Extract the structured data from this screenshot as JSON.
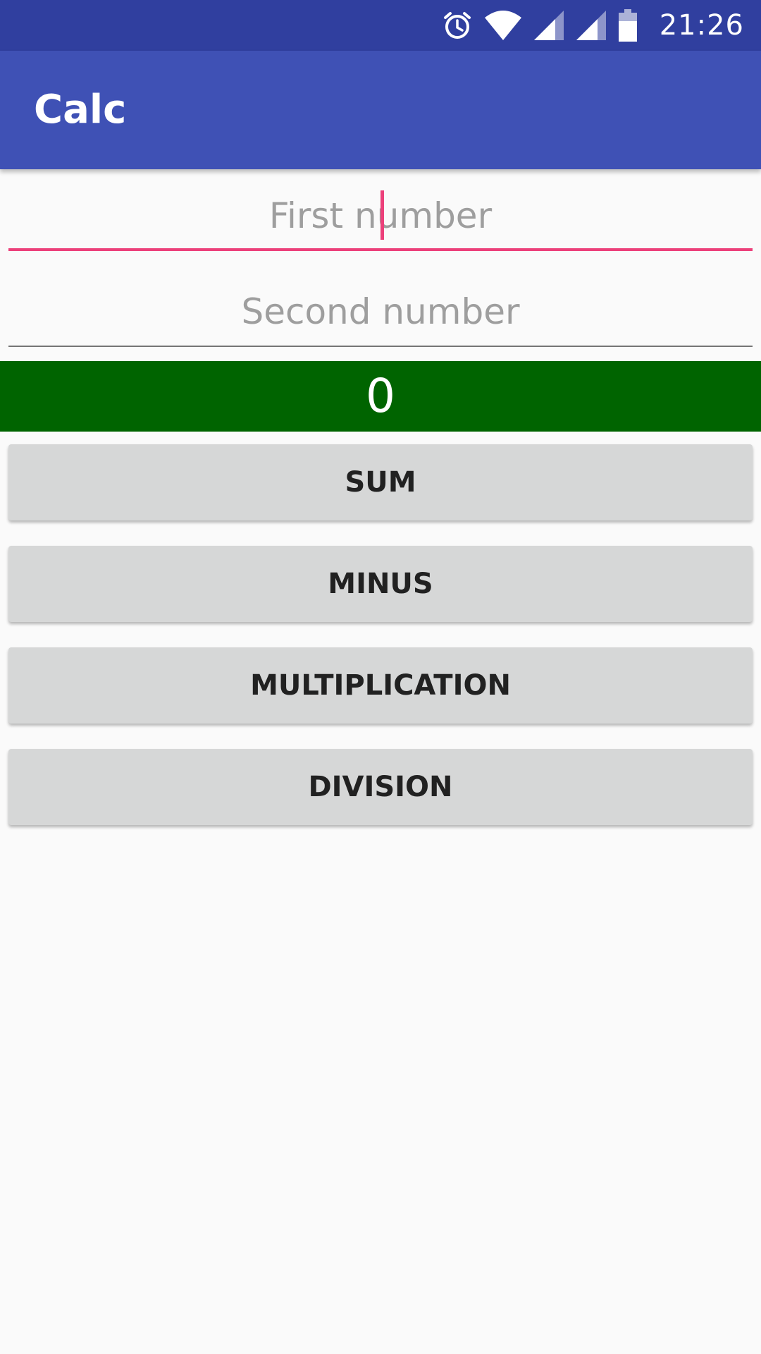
{
  "status_bar": {
    "time": "21:26",
    "icons": [
      "alarm-icon",
      "wifi-icon",
      "signal-icon",
      "signal-icon",
      "battery-icon"
    ]
  },
  "app_bar": {
    "title": "Calc"
  },
  "inputs": {
    "first": {
      "placeholder": "First number",
      "value": ""
    },
    "second": {
      "placeholder": "Second number",
      "value": ""
    }
  },
  "result": {
    "value": "0",
    "background": "#006400"
  },
  "buttons": {
    "sum": "SUM",
    "minus": "MINUS",
    "multiplication": "MULTIPLICATION",
    "division": "DIVISION"
  },
  "colors": {
    "status_bar": "#303f9f",
    "app_bar": "#3f51b5",
    "accent": "#ec407a",
    "button_bg": "#d6d7d7"
  }
}
